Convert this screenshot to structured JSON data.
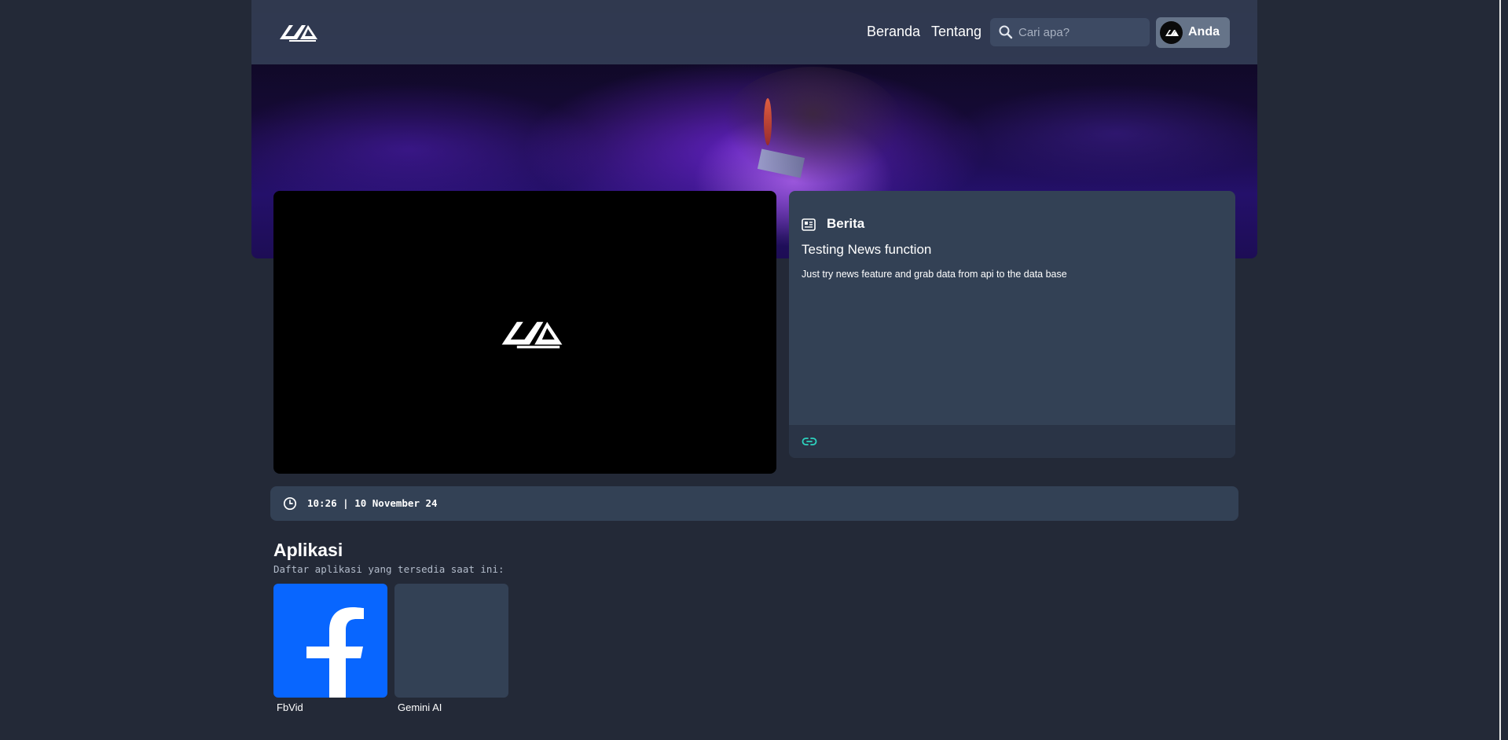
{
  "header": {
    "nav": [
      {
        "label": "Beranda"
      },
      {
        "label": "Tentang"
      }
    ],
    "search": {
      "placeholder": "Cari apa?",
      "value": ""
    },
    "user": {
      "label": "Anda"
    }
  },
  "news": {
    "section_title": "Berita",
    "title": "Testing News function",
    "body": "Just try news feature and grab data from api to the data base"
  },
  "clock": {
    "text": "10:26 | 10 November 24"
  },
  "apps": {
    "title": "Aplikasi",
    "subtitle": "Daftar aplikasi yang tersedia saat ini:",
    "items": [
      {
        "name": "FbVid",
        "icon": "facebook-icon"
      },
      {
        "name": "Gemini AI",
        "icon": "placeholder-tile"
      }
    ]
  },
  "colors": {
    "background": "#232937",
    "card": "#334155",
    "accent_link": "#2dd4bf",
    "facebook": "#0866ff"
  }
}
